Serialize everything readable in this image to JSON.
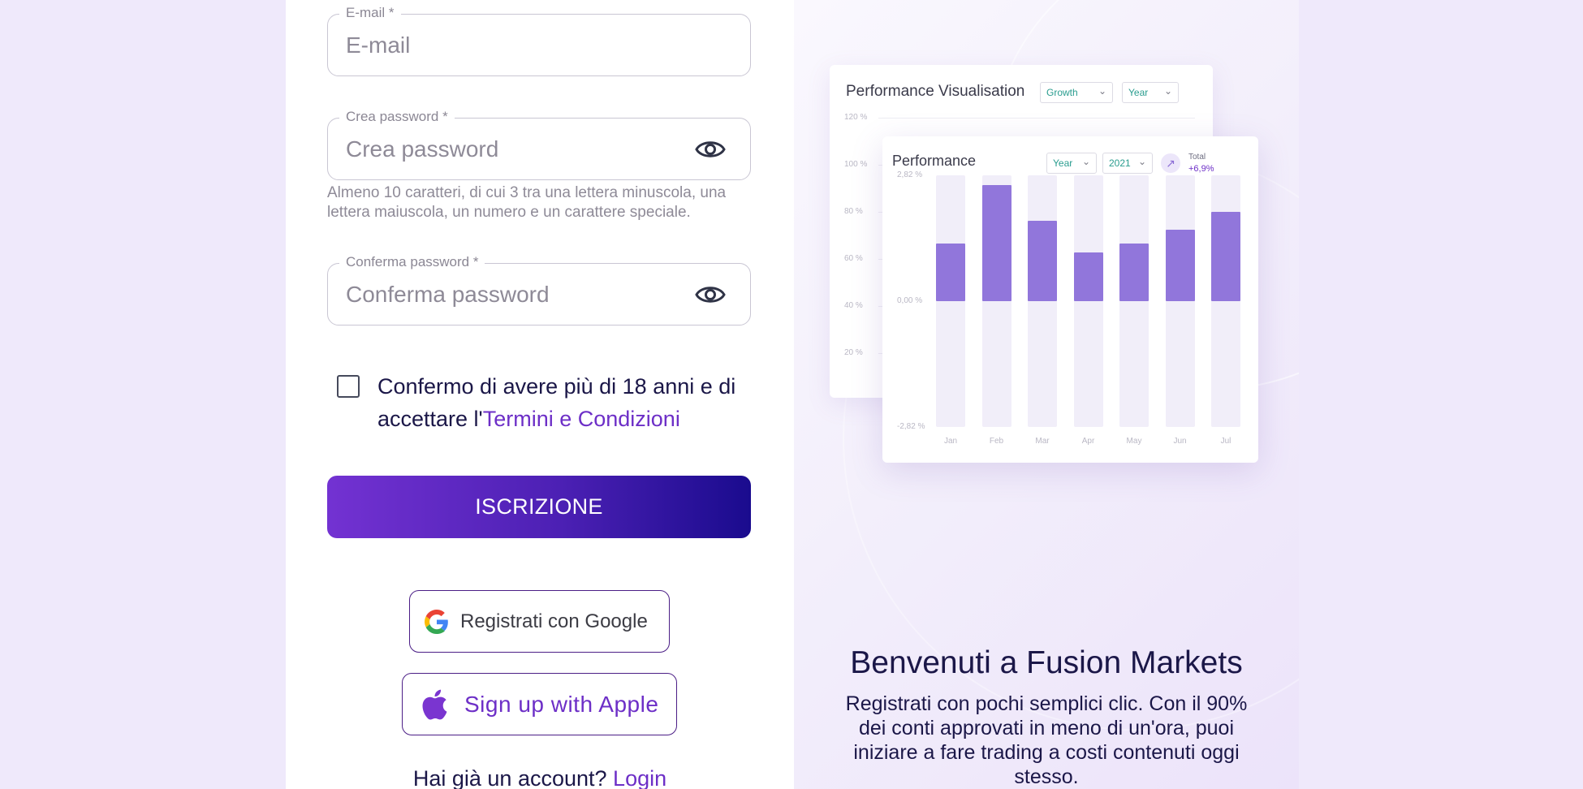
{
  "form": {
    "email": {
      "label": "E-mail",
      "required_mark": "*",
      "placeholder": "E-mail"
    },
    "password": {
      "label": "Crea password",
      "required_mark": "*",
      "placeholder": "Crea password",
      "hint": "Almeno 10 caratteri, di cui 3 tra una lettera minuscola, una lettera maiuscola, un numero e un carattere speciale."
    },
    "confirm_password": {
      "label": "Conferma password",
      "required_mark": "*",
      "placeholder": "Conferma password"
    },
    "consent": {
      "text_before": "Confermo di avere più di 18 anni e di accettare l'",
      "link_text": "Termini e Condizioni",
      "checked": false
    },
    "submit_label": "ISCRIZIONE",
    "google_label": "Registrati con Google",
    "apple_label": "Sign up with Apple",
    "login_prompt": "Hai già un account?",
    "login_link": "Login"
  },
  "dashboard": {
    "back_card": {
      "title": "Performance Visualisation",
      "select1": "Growth",
      "select2": "Year",
      "y_ticks": [
        "120 %",
        "100 %",
        "80 %",
        "60 %",
        "40 %",
        "20 %"
      ]
    },
    "front_card": {
      "title": "Performance",
      "select1": "Year",
      "select2": "2021",
      "total_label": "Total",
      "total_value": "+6,9%",
      "trend_icon": "arrow-up-right-icon"
    }
  },
  "chart_data": {
    "type": "bar",
    "title": "Performance",
    "categories": [
      "Jan",
      "Feb",
      "Mar",
      "Apr",
      "May",
      "Jun",
      "Jul"
    ],
    "values": [
      1.3,
      2.6,
      1.8,
      1.1,
      1.3,
      1.6,
      2.0
    ],
    "y_ticks": [
      "2,82 %",
      "0,00 %",
      "-2,82 %"
    ],
    "ylim": [
      -2.82,
      2.82
    ],
    "grid": false,
    "legend": "none"
  },
  "welcome": {
    "title": "Benvenuti a Fusion Markets",
    "text": "Registrati con pochi semplici clic. Con il 90% dei conti approvati in meno di un'ora, puoi iniziare a fare trading a costi contenuti oggi stesso."
  },
  "colors": {
    "accent": "#6d2fc7",
    "button_gradient_start": "#7332d2",
    "button_gradient_end": "#1a0b8e",
    "bar": "#9176db",
    "text_dark": "#1b1748"
  }
}
